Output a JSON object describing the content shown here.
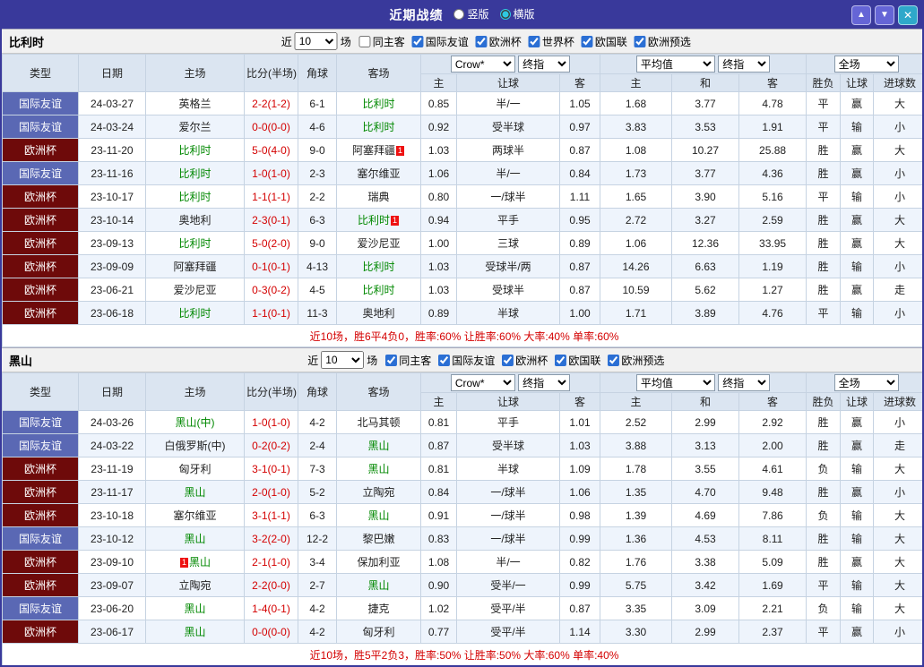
{
  "titlebar": {
    "title": "近期战绩",
    "layout_options": [
      {
        "label": "竖版",
        "selected": false
      },
      {
        "label": "横版",
        "selected": true
      }
    ],
    "buttons": {
      "up": "▲",
      "down": "▼",
      "close": "✕"
    }
  },
  "controls_common": {
    "near": "近",
    "count": "10",
    "matches": "场"
  },
  "table_header": {
    "type": "类型",
    "date": "日期",
    "home": "主场",
    "score": "比分(半场)",
    "corner": "角球",
    "away": "客场",
    "odds_bookmaker": "Crow*",
    "odds_stage": "终指",
    "avg_bookmaker": "平均值",
    "avg_stage": "终指",
    "scope": "全场",
    "odds_sub": [
      "主",
      "让球",
      "客"
    ],
    "avg_sub": [
      "主",
      "和",
      "客"
    ],
    "result_sub": [
      "胜负",
      "让球",
      "进球数"
    ]
  },
  "colors": {
    "titlebar_bg": "#39399b",
    "nav_btn_bg": "#6565d6",
    "close_btn_bg": "#2fa8ca",
    "header_bg": "#dbe5f1",
    "row_alt_bg": "#eef4fc",
    "friendly_badge": "#5a68b4",
    "eurocup_badge": "#6e0a0a",
    "focus_team": "#008800",
    "score_color": "#d40000",
    "win_color": "#d40000",
    "draw_color": "#008800",
    "loss_color": "#0044bb",
    "summary_color": "#d40000",
    "grid_border": "#c6d3e2"
  },
  "sections": [
    {
      "team": "比利时",
      "filters": [
        {
          "label": "同主客",
          "checked": false
        },
        {
          "label": "国际友谊",
          "checked": true
        },
        {
          "label": "欧洲杯",
          "checked": true
        },
        {
          "label": "世界杯",
          "checked": true
        },
        {
          "label": "欧国联",
          "checked": true
        },
        {
          "label": "欧洲预选",
          "checked": true
        }
      ],
      "summary": "近10场，胜6平4负0，胜率:60%  让胜率:60%  大率:40%  单率:60%",
      "rows": [
        {
          "type": "国际友谊",
          "type_key": "friendly",
          "date": "24-03-27",
          "home": {
            "name": "英格兰",
            "focus": false
          },
          "score": "2-2(1-2)",
          "corner": "6-1",
          "away": {
            "name": "比利时",
            "focus": true
          },
          "odds": [
            "0.85",
            "半/一",
            "1.05"
          ],
          "avg": [
            "1.68",
            "3.77",
            "4.78"
          ],
          "result": [
            "平",
            "赢",
            "大"
          ]
        },
        {
          "type": "国际友谊",
          "type_key": "friendly",
          "date": "24-03-24",
          "home": {
            "name": "爱尔兰",
            "focus": false
          },
          "score": "0-0(0-0)",
          "corner": "4-6",
          "away": {
            "name": "比利时",
            "focus": true
          },
          "odds": [
            "0.92",
            "受半球",
            "0.97"
          ],
          "avg": [
            "3.83",
            "3.53",
            "1.91"
          ],
          "result": [
            "平",
            "输",
            "小"
          ]
        },
        {
          "type": "欧洲杯",
          "type_key": "eurocup",
          "date": "23-11-20",
          "home": {
            "name": "比利时",
            "focus": true
          },
          "score": "5-0(4-0)",
          "corner": "9-0",
          "away": {
            "name": "阿塞拜疆",
            "focus": false,
            "card": "1",
            "card_pos": "after"
          },
          "odds": [
            "1.03",
            "两球半",
            "0.87"
          ],
          "avg": [
            "1.08",
            "10.27",
            "25.88"
          ],
          "result": [
            "胜",
            "赢",
            "大"
          ]
        },
        {
          "type": "国际友谊",
          "type_key": "friendly",
          "date": "23-11-16",
          "home": {
            "name": "比利时",
            "focus": true
          },
          "score": "1-0(1-0)",
          "corner": "2-3",
          "away": {
            "name": "塞尔维亚",
            "focus": false
          },
          "odds": [
            "1.06",
            "半/一",
            "0.84"
          ],
          "avg": [
            "1.73",
            "3.77",
            "4.36"
          ],
          "result": [
            "胜",
            "赢",
            "小"
          ]
        },
        {
          "type": "欧洲杯",
          "type_key": "eurocup",
          "date": "23-10-17",
          "home": {
            "name": "比利时",
            "focus": true
          },
          "score": "1-1(1-1)",
          "corner": "2-2",
          "away": {
            "name": "瑞典",
            "focus": false
          },
          "odds": [
            "0.80",
            "一/球半",
            "1.11"
          ],
          "avg": [
            "1.65",
            "3.90",
            "5.16"
          ],
          "result": [
            "平",
            "输",
            "小"
          ]
        },
        {
          "type": "欧洲杯",
          "type_key": "eurocup",
          "date": "23-10-14",
          "home": {
            "name": "奥地利",
            "focus": false
          },
          "score": "2-3(0-1)",
          "corner": "6-3",
          "away": {
            "name": "比利时",
            "focus": true,
            "card": "1",
            "card_pos": "after"
          },
          "odds": [
            "0.94",
            "平手",
            "0.95"
          ],
          "avg": [
            "2.72",
            "3.27",
            "2.59"
          ],
          "result": [
            "胜",
            "赢",
            "大"
          ]
        },
        {
          "type": "欧洲杯",
          "type_key": "eurocup",
          "date": "23-09-13",
          "home": {
            "name": "比利时",
            "focus": true
          },
          "score": "5-0(2-0)",
          "corner": "9-0",
          "away": {
            "name": "爱沙尼亚",
            "focus": false
          },
          "odds": [
            "1.00",
            "三球",
            "0.89"
          ],
          "avg": [
            "1.06",
            "12.36",
            "33.95"
          ],
          "result": [
            "胜",
            "赢",
            "大"
          ]
        },
        {
          "type": "欧洲杯",
          "type_key": "eurocup",
          "date": "23-09-09",
          "home": {
            "name": "阿塞拜疆",
            "focus": false
          },
          "score": "0-1(0-1)",
          "corner": "4-13",
          "away": {
            "name": "比利时",
            "focus": true
          },
          "odds": [
            "1.03",
            "受球半/两",
            "0.87"
          ],
          "avg": [
            "14.26",
            "6.63",
            "1.19"
          ],
          "result": [
            "胜",
            "输",
            "小"
          ]
        },
        {
          "type": "欧洲杯",
          "type_key": "eurocup",
          "date": "23-06-21",
          "home": {
            "name": "爱沙尼亚",
            "focus": false
          },
          "score": "0-3(0-2)",
          "corner": "4-5",
          "away": {
            "name": "比利时",
            "focus": true
          },
          "odds": [
            "1.03",
            "受球半",
            "0.87"
          ],
          "avg": [
            "10.59",
            "5.62",
            "1.27"
          ],
          "result": [
            "胜",
            "赢",
            "走"
          ]
        },
        {
          "type": "欧洲杯",
          "type_key": "eurocup",
          "date": "23-06-18",
          "home": {
            "name": "比利时",
            "focus": true
          },
          "score": "1-1(0-1)",
          "corner": "11-3",
          "away": {
            "name": "奥地利",
            "focus": false
          },
          "odds": [
            "0.89",
            "半球",
            "1.00"
          ],
          "avg": [
            "1.71",
            "3.89",
            "4.76"
          ],
          "result": [
            "平",
            "输",
            "小"
          ]
        }
      ]
    },
    {
      "team": "黑山",
      "filters": [
        {
          "label": "同主客",
          "checked": true
        },
        {
          "label": "国际友谊",
          "checked": true
        },
        {
          "label": "欧洲杯",
          "checked": true
        },
        {
          "label": "欧国联",
          "checked": true
        },
        {
          "label": "欧洲预选",
          "checked": true
        }
      ],
      "summary": "近10场，胜5平2负3，胜率:50%  让胜率:50%  大率:60%  单率:40%",
      "rows": [
        {
          "type": "国际友谊",
          "type_key": "friendly",
          "date": "24-03-26",
          "home": {
            "name": "黑山(中)",
            "focus": true
          },
          "score": "1-0(1-0)",
          "corner": "4-2",
          "away": {
            "name": "北马其顿",
            "focus": false
          },
          "odds": [
            "0.81",
            "平手",
            "1.01"
          ],
          "avg": [
            "2.52",
            "2.99",
            "2.92"
          ],
          "result": [
            "胜",
            "赢",
            "小"
          ]
        },
        {
          "type": "国际友谊",
          "type_key": "friendly",
          "date": "24-03-22",
          "home": {
            "name": "白俄罗斯(中)",
            "focus": false
          },
          "score": "0-2(0-2)",
          "corner": "2-4",
          "away": {
            "name": "黑山",
            "focus": true
          },
          "odds": [
            "0.87",
            "受半球",
            "1.03"
          ],
          "avg": [
            "3.88",
            "3.13",
            "2.00"
          ],
          "result": [
            "胜",
            "赢",
            "走"
          ]
        },
        {
          "type": "欧洲杯",
          "type_key": "eurocup",
          "date": "23-11-19",
          "home": {
            "name": "匈牙利",
            "focus": false
          },
          "score": "3-1(0-1)",
          "corner": "7-3",
          "away": {
            "name": "黑山",
            "focus": true
          },
          "odds": [
            "0.81",
            "半球",
            "1.09"
          ],
          "avg": [
            "1.78",
            "3.55",
            "4.61"
          ],
          "result": [
            "负",
            "输",
            "大"
          ]
        },
        {
          "type": "欧洲杯",
          "type_key": "eurocup",
          "date": "23-11-17",
          "home": {
            "name": "黑山",
            "focus": true
          },
          "score": "2-0(1-0)",
          "corner": "5-2",
          "away": {
            "name": "立陶宛",
            "focus": false
          },
          "odds": [
            "0.84",
            "一/球半",
            "1.06"
          ],
          "avg": [
            "1.35",
            "4.70",
            "9.48"
          ],
          "result": [
            "胜",
            "赢",
            "小"
          ]
        },
        {
          "type": "欧洲杯",
          "type_key": "eurocup",
          "date": "23-10-18",
          "home": {
            "name": "塞尔维亚",
            "focus": false
          },
          "score": "3-1(1-1)",
          "corner": "6-3",
          "away": {
            "name": "黑山",
            "focus": true
          },
          "odds": [
            "0.91",
            "一/球半",
            "0.98"
          ],
          "avg": [
            "1.39",
            "4.69",
            "7.86"
          ],
          "result": [
            "负",
            "输",
            "大"
          ]
        },
        {
          "type": "国际友谊",
          "type_key": "friendly",
          "date": "23-10-12",
          "home": {
            "name": "黑山",
            "focus": true
          },
          "score": "3-2(2-0)",
          "corner": "12-2",
          "away": {
            "name": "黎巴嫩",
            "focus": false
          },
          "odds": [
            "0.83",
            "一/球半",
            "0.99"
          ],
          "avg": [
            "1.36",
            "4.53",
            "8.11"
          ],
          "result": [
            "胜",
            "输",
            "大"
          ]
        },
        {
          "type": "欧洲杯",
          "type_key": "eurocup",
          "date": "23-09-10",
          "home": {
            "name": "黑山",
            "focus": true,
            "card": "1",
            "card_pos": "before"
          },
          "score": "2-1(1-0)",
          "corner": "3-4",
          "away": {
            "name": "保加利亚",
            "focus": false
          },
          "odds": [
            "1.08",
            "半/一",
            "0.82"
          ],
          "avg": [
            "1.76",
            "3.38",
            "5.09"
          ],
          "result": [
            "胜",
            "赢",
            "大"
          ]
        },
        {
          "type": "欧洲杯",
          "type_key": "eurocup",
          "date": "23-09-07",
          "home": {
            "name": "立陶宛",
            "focus": false
          },
          "score": "2-2(0-0)",
          "corner": "2-7",
          "away": {
            "name": "黑山",
            "focus": true
          },
          "odds": [
            "0.90",
            "受半/一",
            "0.99"
          ],
          "avg": [
            "5.75",
            "3.42",
            "1.69"
          ],
          "result": [
            "平",
            "输",
            "大"
          ]
        },
        {
          "type": "国际友谊",
          "type_key": "friendly",
          "date": "23-06-20",
          "home": {
            "name": "黑山",
            "focus": true
          },
          "score": "1-4(0-1)",
          "corner": "4-2",
          "away": {
            "name": "捷克",
            "focus": false
          },
          "odds": [
            "1.02",
            "受平/半",
            "0.87"
          ],
          "avg": [
            "3.35",
            "3.09",
            "2.21"
          ],
          "result": [
            "负",
            "输",
            "大"
          ]
        },
        {
          "type": "欧洲杯",
          "type_key": "eurocup",
          "date": "23-06-17",
          "home": {
            "name": "黑山",
            "focus": true
          },
          "score": "0-0(0-0)",
          "corner": "4-2",
          "away": {
            "name": "匈牙利",
            "focus": false
          },
          "odds": [
            "0.77",
            "受平/半",
            "1.14"
          ],
          "avg": [
            "3.30",
            "2.99",
            "2.37"
          ],
          "result": [
            "平",
            "赢",
            "小"
          ]
        }
      ]
    }
  ]
}
